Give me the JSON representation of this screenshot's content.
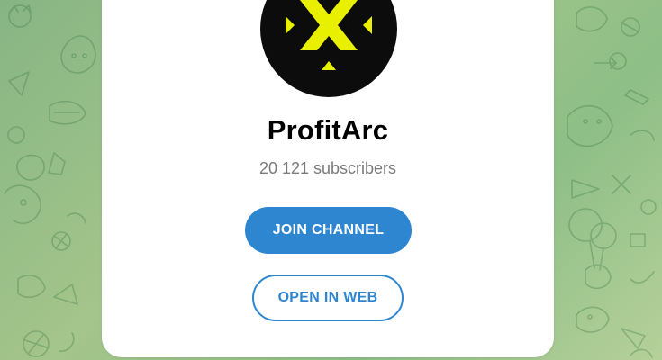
{
  "channel": {
    "name": "ProfitArc",
    "subscribers": "20 121 subscribers",
    "avatar_icon": "profitarc-logo-icon"
  },
  "actions": {
    "join_label": "JOIN CHANNEL",
    "web_label": "OPEN IN WEB"
  },
  "colors": {
    "accent": "#2f86d0",
    "logo_yellow": "#e8f000",
    "avatar_bg": "#0c0c0c",
    "background": "#9cc287"
  }
}
